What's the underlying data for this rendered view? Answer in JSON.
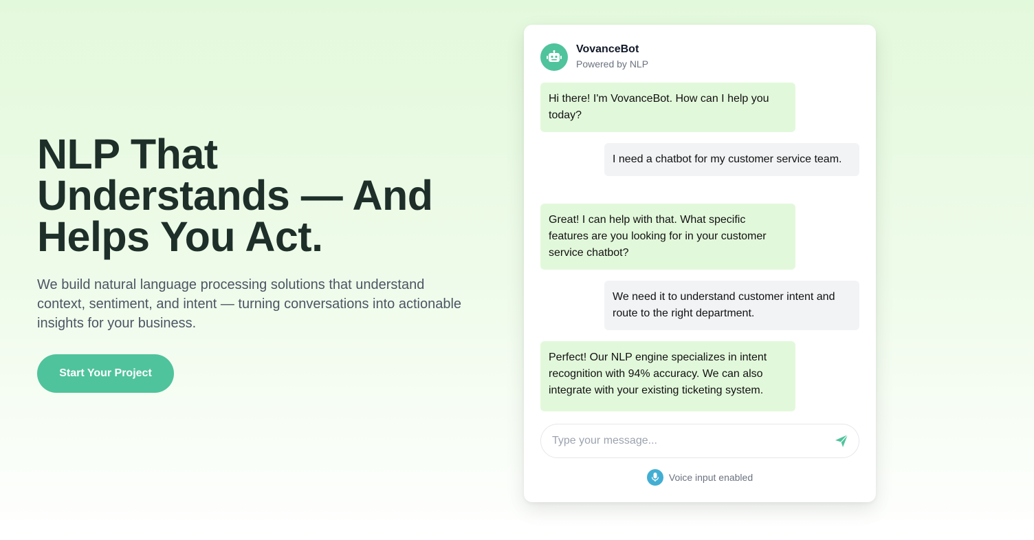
{
  "hero": {
    "title_line1": "NLP That",
    "title_line2": "Understands — And",
    "title_line3": "Helps You Act.",
    "description": "We build natural language processing solutions that understand context, sentiment, and intent — turning conversations into actionable insights for your business.",
    "cta_label": "Start Your Project"
  },
  "chat": {
    "bot_name": "VovanceBot",
    "bot_subtitle": "Powered by NLP",
    "avatar_icon": "robot-icon",
    "messages": [
      {
        "sender": "bot",
        "text": "Hi there! I'm VovanceBot. How can I help you today?"
      },
      {
        "sender": "user",
        "text": "I need a chatbot for my customer service team."
      },
      {
        "sender": "bot",
        "text": "Great! I can help with that. What specific features are you looking for in your customer service chatbot?"
      },
      {
        "sender": "user",
        "text": "We need it to understand customer intent and route to the right department."
      },
      {
        "sender": "bot",
        "text": "Perfect! Our NLP engine specializes in intent recognition with 94% accuracy. We can also integrate with your existing ticketing system."
      }
    ],
    "input_placeholder": "Type your message...",
    "send_icon": "send-icon",
    "voice_label": "Voice input enabled",
    "voice_icon": "microphone-icon"
  },
  "colors": {
    "accent": "#4fc39c",
    "bot_bubble": "#e2f8db",
    "user_bubble": "#f2f3f5",
    "mic": "#43aed3",
    "heading": "#1e2f2a"
  }
}
